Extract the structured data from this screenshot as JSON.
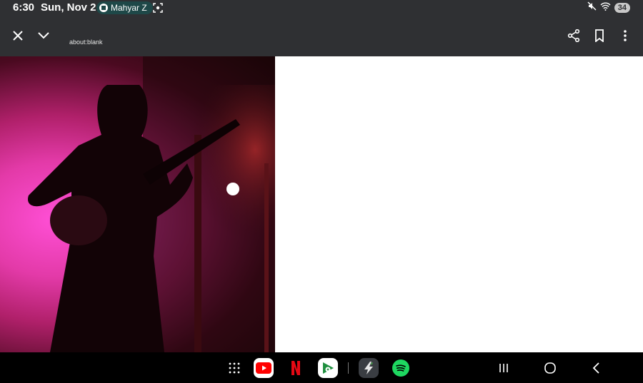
{
  "status_bar": {
    "time": "6:30",
    "date": "Sun, Nov 2",
    "media_pill": "Mahyar Z",
    "battery": "34"
  },
  "browser": {
    "url": "about:blank"
  },
  "colors": {
    "topbar": "#2f3033",
    "pill": "#1e4848",
    "youtube": "#ff0000",
    "netflix": "#e50914",
    "spotify": "#1ed760"
  },
  "nav_icons": [
    "apps-grid-icon",
    "youtube-app-icon",
    "netflix-app-icon",
    "play-games-app-icon",
    "bolt-app-icon",
    "spotify-app-icon",
    "recents-icon",
    "home-icon",
    "back-icon"
  ]
}
